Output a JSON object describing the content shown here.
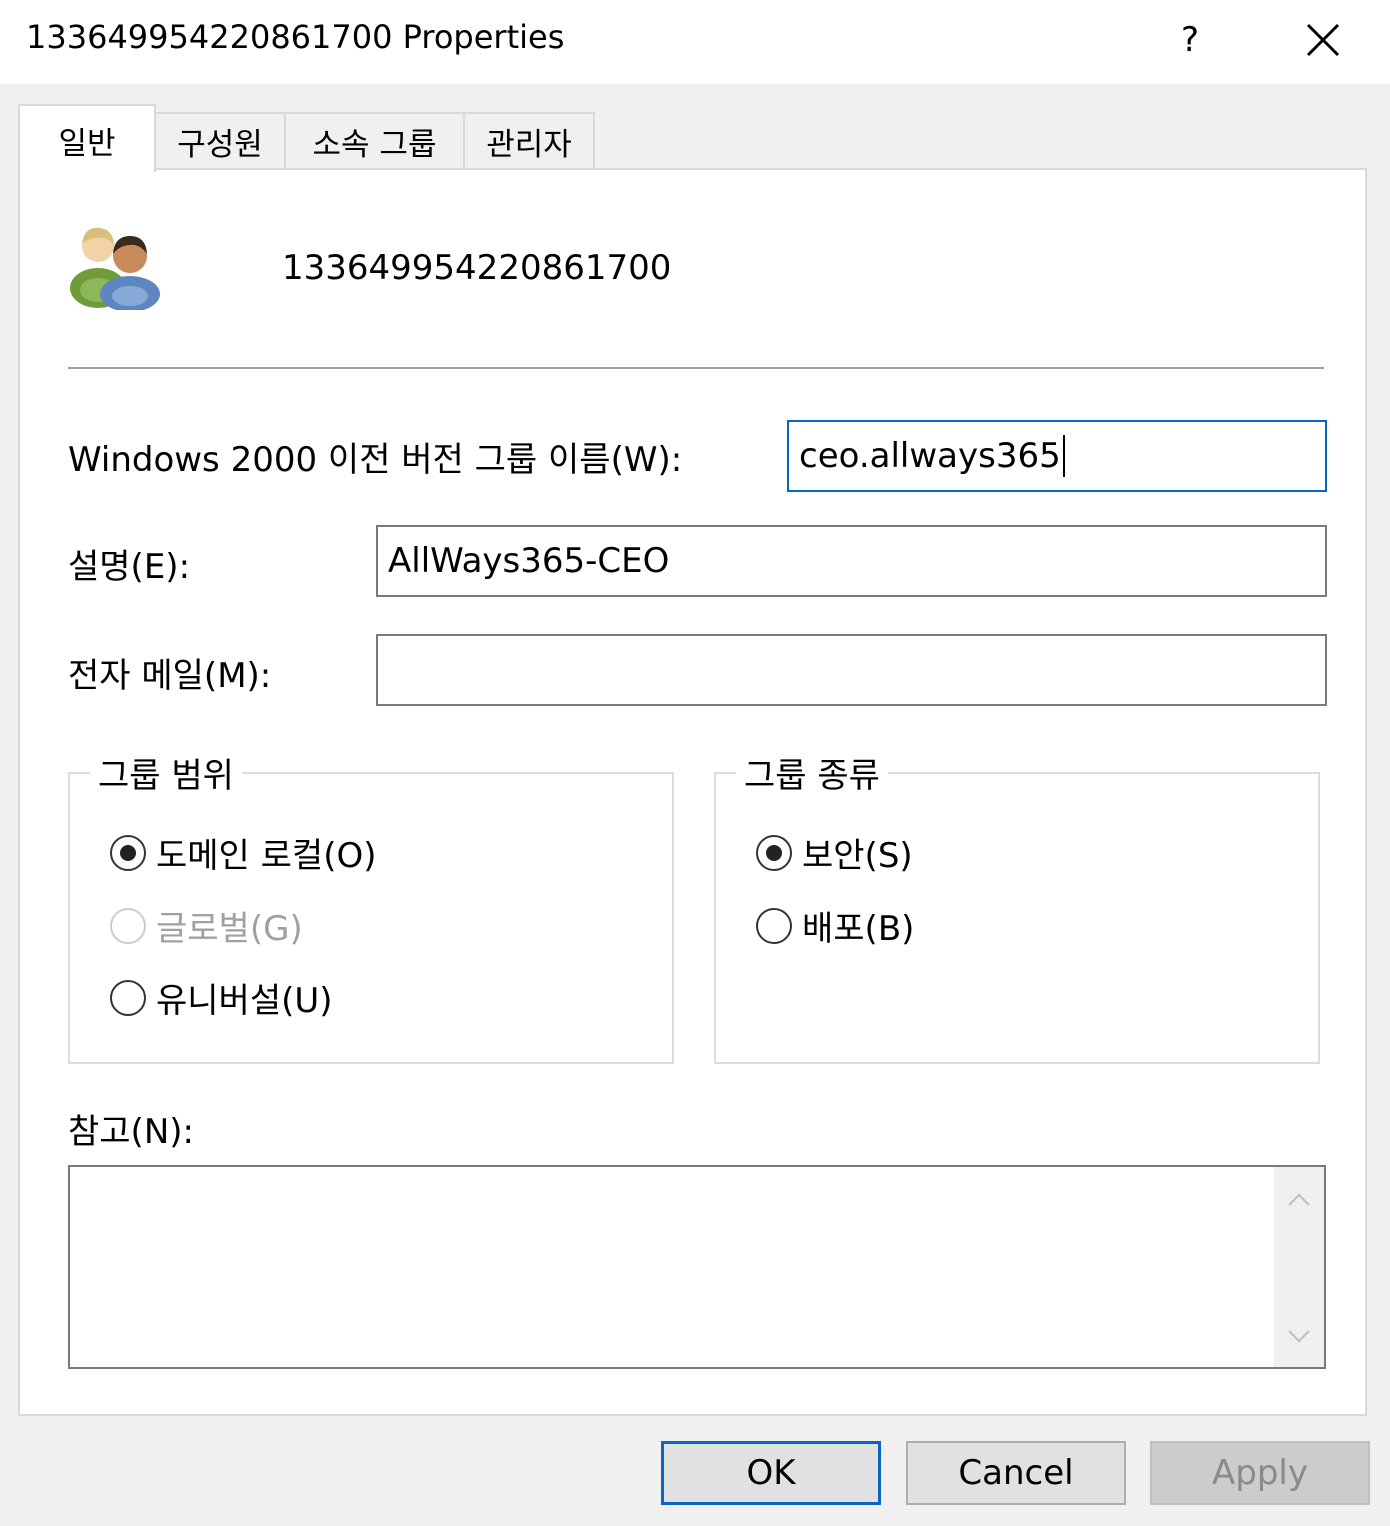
{
  "window": {
    "title": "133649954220861700 Properties",
    "help_label": "?",
    "close_icon": "close-icon"
  },
  "tabs": [
    {
      "label": "일반",
      "active": true
    },
    {
      "label": "구성원",
      "active": false
    },
    {
      "label": "소속 그룹",
      "active": false
    },
    {
      "label": "관리자",
      "active": false
    }
  ],
  "general": {
    "group_icon": "group-users-icon",
    "group_name": "133649954220861700",
    "pre2000_label": "Windows 2000 이전 버전 그룹 이름(W):",
    "pre2000_value": "ceo.allways365",
    "description_label": "설명(E):",
    "description_value": "AllWays365-CEO",
    "email_label": "전자 메일(M):",
    "email_value": "",
    "notes_label": "참고(N):",
    "notes_value": ""
  },
  "group_scope": {
    "title": "그룹 범위",
    "options": [
      {
        "label": "도메인 로컬(O)",
        "checked": true,
        "enabled": true
      },
      {
        "label": "글로벌(G)",
        "checked": false,
        "enabled": false
      },
      {
        "label": "유니버설(U)",
        "checked": false,
        "enabled": true
      }
    ]
  },
  "group_type": {
    "title": "그룹 종류",
    "options": [
      {
        "label": "보안(S)",
        "checked": true,
        "enabled": true
      },
      {
        "label": "배포(B)",
        "checked": false,
        "enabled": true
      }
    ]
  },
  "buttons": {
    "ok": "OK",
    "cancel": "Cancel",
    "apply": "Apply"
  },
  "colors": {
    "focus_border": "#0a64c8",
    "dialog_bg": "#f0f0f0",
    "panel_bg": "#ffffff"
  }
}
